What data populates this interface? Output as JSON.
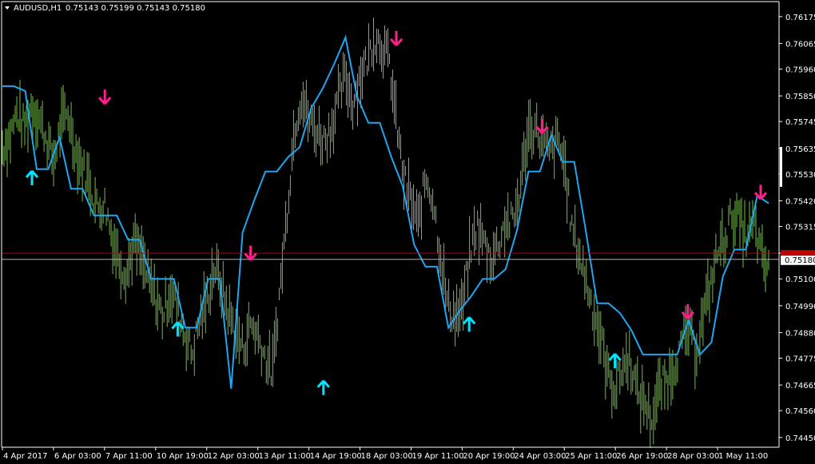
{
  "header": {
    "symbol_timeframe": "AUDUSD,H1",
    "quote": "0.75143 0.75199 0.75143 0.75180"
  },
  "colors": {
    "background": "#000000",
    "price_bars": "#6FBF3F",
    "trailing_line": "#1EA7F0",
    "buy_arrow": "#00E5FF",
    "sell_arrow": "#FF1E8C",
    "bid_line": "#C00000",
    "text": "#FFFFFF",
    "axis": "#FFFFFF"
  },
  "chart_data": {
    "type": "line",
    "title": "",
    "ylim": [
      0.7441,
      0.7623
    ],
    "y_ticks": [
      "0.76175",
      "0.76065",
      "0.75960",
      "0.75850",
      "0.75745",
      "0.75635",
      "0.75530",
      "0.75420",
      "0.75315",
      "0.75205",
      "0.75100",
      "0.74990",
      "0.74880",
      "0.74775",
      "0.74665",
      "0.74560",
      "0.74450"
    ],
    "x_labels": [
      "4 Apr 2017",
      "6 Apr 03:00",
      "7 Apr 11:00",
      "10 Apr 19:00",
      "12 Apr 03:00",
      "13 Apr 11:00",
      "14 Apr 19:00",
      "18 Apr 03:00",
      "19 Apr 11:00",
      "20 Apr 19:00",
      "24 Apr 03:00",
      "25 Apr 11:00",
      "26 Apr 19:00",
      "28 Apr 03:00",
      "1 May 11:00"
    ],
    "current_price": 0.7518,
    "current_price_label": "0.75180",
    "red_line_price": 0.75205,
    "price_series": {
      "name": "",
      "values": [
        0.7564,
        0.7568,
        0.7578,
        0.7572,
        0.7581,
        0.7576,
        0.7568,
        0.7558,
        0.7573,
        0.7578,
        0.7563,
        0.7555,
        0.7549,
        0.7539,
        0.7541,
        0.7528,
        0.7518,
        0.7512,
        0.7525,
        0.7519,
        0.7509,
        0.7502,
        0.7495,
        0.7506,
        0.7498,
        0.7488,
        0.7479,
        0.7493,
        0.7501,
        0.7515,
        0.7507,
        0.7496,
        0.7489,
        0.7481,
        0.7492,
        0.7487,
        0.7478,
        0.7471,
        0.7505,
        0.7538,
        0.7572,
        0.7586,
        0.7575,
        0.7571,
        0.7567,
        0.7572,
        0.7583,
        0.7593,
        0.7582,
        0.7593,
        0.76,
        0.761,
        0.7606,
        0.7599,
        0.7574,
        0.7551,
        0.7542,
        0.7532,
        0.7552,
        0.7543,
        0.7521,
        0.7499,
        0.7495,
        0.7497,
        0.7519,
        0.7532,
        0.7525,
        0.7518,
        0.7525,
        0.7534,
        0.7533,
        0.7548,
        0.7571,
        0.7572,
        0.7566,
        0.7561,
        0.7567,
        0.7558,
        0.7531,
        0.7521,
        0.7509,
        0.7497,
        0.7486,
        0.747,
        0.7465,
        0.7474,
        0.7478,
        0.7463,
        0.746,
        0.7452,
        0.7465,
        0.7468,
        0.7475,
        0.7482,
        0.7489,
        0.748,
        0.7494,
        0.7507,
        0.7521,
        0.7527,
        0.7537,
        0.7533,
        0.7527,
        0.7532,
        0.7519,
        0.7513
      ]
    },
    "trailing_stop_series": {
      "name": "",
      "values": [
        0.7589,
        0.7589,
        0.7587,
        0.7555,
        0.7555,
        0.7568,
        0.7547,
        0.7547,
        0.7536,
        0.7536,
        0.7536,
        0.7526,
        0.7526,
        0.751,
        0.751,
        0.751,
        0.749,
        0.749,
        0.751,
        0.751,
        0.7465,
        0.7529,
        0.7542,
        0.7554,
        0.7554,
        0.756,
        0.7564,
        0.758,
        0.7588,
        0.7598,
        0.7609,
        0.7585,
        0.7574,
        0.7574,
        0.756,
        0.7548,
        0.7524,
        0.7515,
        0.7515,
        0.749,
        0.7497,
        0.7503,
        0.751,
        0.751,
        0.7514,
        0.753,
        0.7554,
        0.7554,
        0.7569,
        0.7558,
        0.7558,
        0.753,
        0.75,
        0.75,
        0.7496,
        0.7489,
        0.7479,
        0.7479,
        0.7479,
        0.7479,
        0.7493,
        0.7479,
        0.7484,
        0.7511,
        0.7522,
        0.7522,
        0.7544,
        0.7541
      ]
    },
    "signals": [
      {
        "type": "buy",
        "price": 0.7551
      },
      {
        "type": "sell",
        "price": 0.7585
      },
      {
        "type": "buy",
        "price": 0.7489
      },
      {
        "type": "sell",
        "price": 0.7521
      },
      {
        "type": "buy",
        "price": 0.7465
      },
      {
        "type": "sell",
        "price": 0.7609
      },
      {
        "type": "buy",
        "price": 0.7491
      },
      {
        "type": "sell",
        "price": 0.7573
      },
      {
        "type": "buy",
        "price": 0.7476
      },
      {
        "type": "sell",
        "price": 0.7497
      },
      {
        "type": "sell",
        "price": 0.7546
      }
    ]
  }
}
